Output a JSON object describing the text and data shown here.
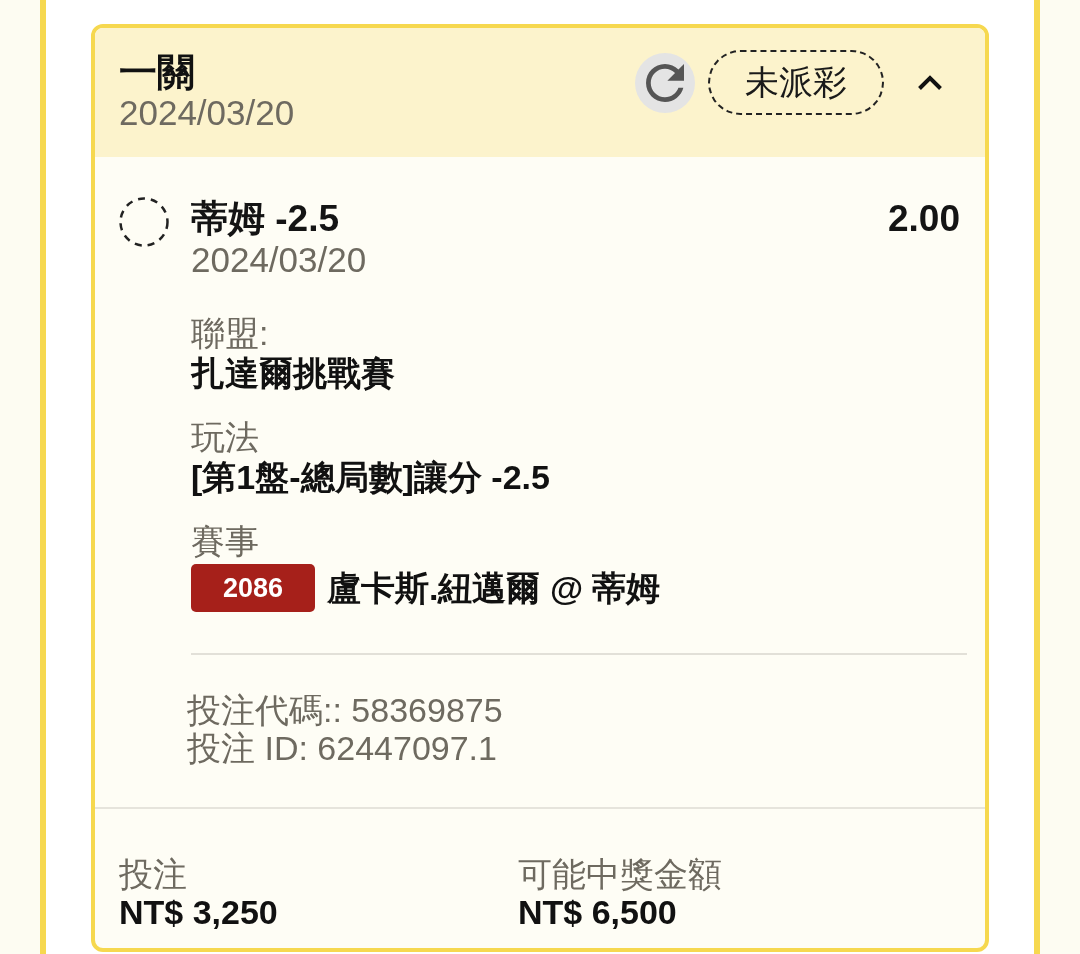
{
  "bet": {
    "title": "一關",
    "date": "2024/03/20",
    "status": "未派彩",
    "expanded": true
  },
  "selection": {
    "name": "蒂姆 -2.5",
    "odds": "2.00",
    "date": "2024/03/20",
    "settled": false
  },
  "details": [
    {
      "label": "聯盟:",
      "value": "扎達爾挑戰賽"
    },
    {
      "label": "玩法",
      "value": "[第1盤-總局數]讓分 -2.5"
    },
    {
      "label": "賽事",
      "badge": "2086",
      "value": "盧卡斯.紐邁爾 @ 蒂姆"
    }
  ],
  "references": [
    "投注代碼:: 58369875",
    "投注 ID: 62447097.1"
  ],
  "summary": [
    {
      "label": "投注",
      "value": "NT$ 3,250"
    },
    {
      "label": "可能中獎金額",
      "value": "NT$ 6,500"
    }
  ]
}
